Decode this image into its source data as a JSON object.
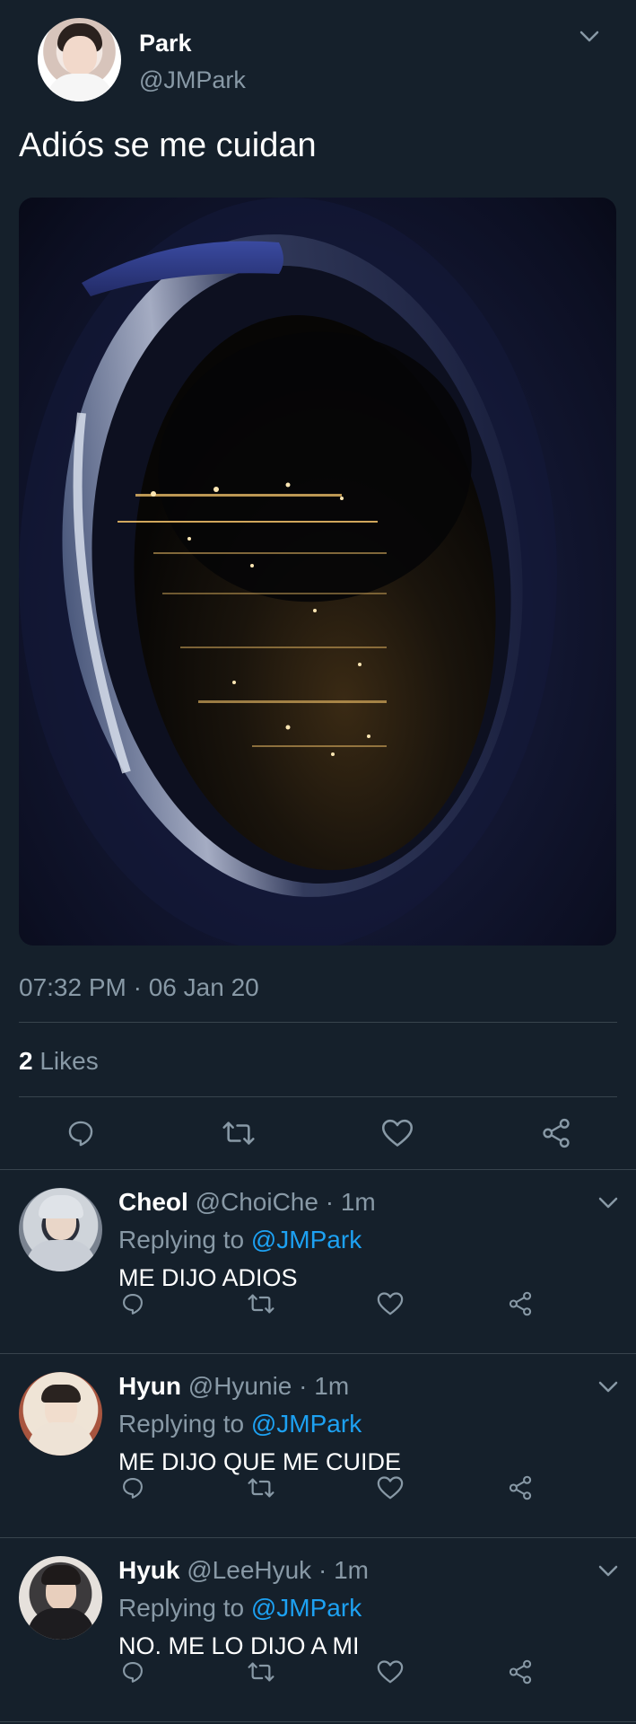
{
  "main_tweet": {
    "display_name": "Park",
    "handle": "@JMPark",
    "text": "Adiós se me cuidan",
    "timestamp": "07:32 PM · 06 Jan 20",
    "likes_count": "2",
    "likes_label": "Likes"
  },
  "replies": [
    {
      "display_name": "Cheol",
      "meta": "@ChoiChe · 1m",
      "replying_prefix": "Replying to",
      "replying_to": "@JMPark",
      "text": "ME DIJO ADIOS"
    },
    {
      "display_name": "Hyun",
      "meta": "@Hyunie · 1m",
      "replying_prefix": "Replying to",
      "replying_to": "@JMPark",
      "text": "ME DIJO QUE ME CUIDE"
    },
    {
      "display_name": "Hyuk",
      "meta": "@LeeHyuk · 1m",
      "replying_prefix": "Replying to",
      "replying_to": "@JMPark",
      "text": "NO. ME LO DIJO A MI"
    }
  ],
  "icons": {
    "reply": "reply-icon",
    "retweet": "retweet-icon",
    "like": "heart-icon",
    "share": "share-icon",
    "more": "chevron-down-icon"
  },
  "colors": {
    "background": "#15202b",
    "secondary_text": "#8899a6",
    "link": "#1da1f2",
    "divider": "#38444d"
  }
}
